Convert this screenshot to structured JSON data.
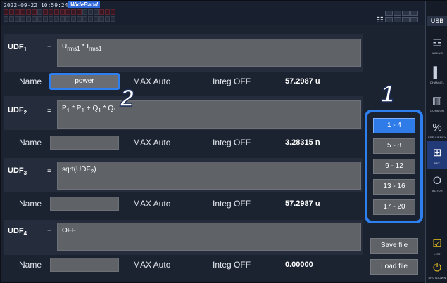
{
  "status": {
    "datetime": "2022-09-22 10:59:24",
    "mode_badge": "WideBand"
  },
  "sidebar": {
    "usb_label": "USB",
    "buttons": [
      {
        "label": "WIRING",
        "icon": "wiring-icon"
      },
      {
        "label": "CHANNEL",
        "icon": "channel-icon"
      },
      {
        "label": "COMMON",
        "icon": "common-icon"
      },
      {
        "label": "EFFICIENCY",
        "icon": "efficiency-icon"
      },
      {
        "label": "UDF",
        "icon": "udf-icon"
      },
      {
        "label": "MOTOR",
        "icon": "motor-icon"
      },
      {
        "label": "LIST",
        "icon": "list-icon"
      },
      {
        "label": "SHUTDOWN",
        "icon": "shutdown-icon"
      }
    ]
  },
  "udfs": [
    {
      "label": "UDF",
      "index": "1",
      "equals": "=",
      "expression_parts": [
        "U",
        "rms1",
        " * I",
        "rms1"
      ],
      "name_label": "Name",
      "name_value": "power",
      "max": "MAX Auto",
      "integ": "Integ OFF",
      "value": "57.2987 u"
    },
    {
      "label": "UDF",
      "index": "2",
      "equals": "=",
      "expression_parts": [
        "P",
        "1",
        " * P",
        "1",
        " + Q",
        "1",
        " * Q",
        "1"
      ],
      "name_label": "Name",
      "name_value": "",
      "max": "MAX Auto",
      "integ": "Integ OFF",
      "value": "3.28315 n"
    },
    {
      "label": "UDF",
      "index": "3",
      "equals": "=",
      "expression_parts": [
        "sqrt(UDF",
        "2",
        ")"
      ],
      "name_label": "Name",
      "name_value": "",
      "max": "MAX Auto",
      "integ": "Integ OFF",
      "value": "57.2987 u"
    },
    {
      "label": "UDF",
      "index": "4",
      "equals": "=",
      "expression_parts": [
        "OFF"
      ],
      "name_label": "Name",
      "name_value": "",
      "max": "MAX Auto",
      "integ": "Integ OFF",
      "value": "0.00000"
    }
  ],
  "range_buttons": [
    "1 - 4",
    "5 - 8",
    "9 - 12",
    "13 - 16",
    "17 - 20"
  ],
  "active_range": "1 - 4",
  "file_buttons": {
    "save": "Save file",
    "load": "Load file"
  },
  "callouts": {
    "one": "1",
    "two": "2"
  },
  "colors": {
    "accent": "#2e7ff0",
    "active_button": "#2f7be8",
    "field": "#5f6368",
    "background": "#1b2230"
  }
}
